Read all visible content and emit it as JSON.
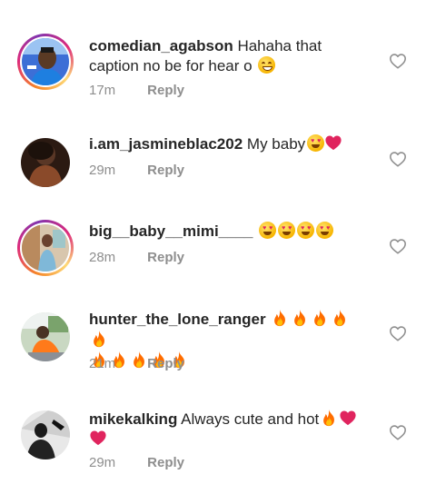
{
  "comments": [
    {
      "username": "comedian_agabson",
      "text_line1": "Hahaha that",
      "text_line2": "caption no be for hear o",
      "time": "17m",
      "reply_label": "Reply",
      "avatar_icon": "profile-photo-man-blue-shirt",
      "story_ring": true
    },
    {
      "username": "i.am_jasmineblac202",
      "text_line1": "My baby",
      "time": "29m",
      "reply_label": "Reply",
      "avatar_icon": "profile-photo-woman-dark",
      "story_ring": false
    },
    {
      "username": "big__baby__mimi____",
      "time": "28m",
      "reply_label": "Reply",
      "avatar_icon": "profile-photo-woman-room",
      "story_ring": true
    },
    {
      "username": "hunter_the_lone_ranger",
      "time": "21m",
      "reply_label": "Reply",
      "avatar_icon": "profile-photo-person-outdoor",
      "story_ring": false
    },
    {
      "username": "mikekalking",
      "text_line1": "Always cute and hot",
      "time": "29m",
      "reply_label": "Reply",
      "avatar_icon": "profile-photo-silhouette",
      "story_ring": false
    }
  ],
  "colors": {
    "text": "#262626",
    "meta": "#8e8e8e",
    "heart_red": "#e0245e",
    "fire": "#ff7a00"
  }
}
